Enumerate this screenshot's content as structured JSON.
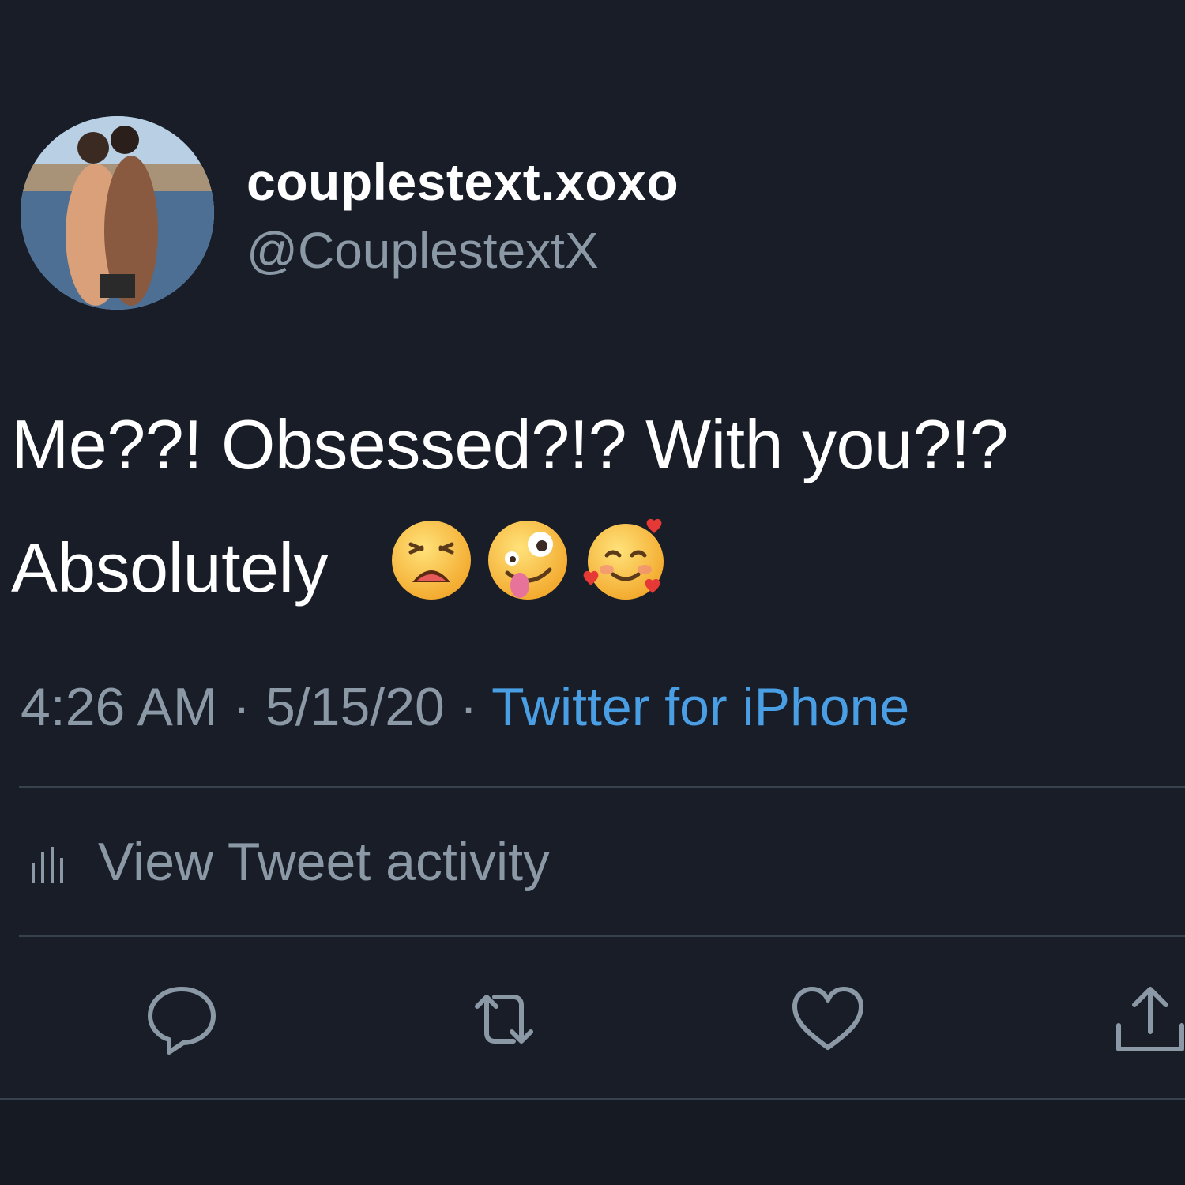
{
  "author": {
    "display_name": "couplestext.xoxo",
    "handle": "@CouplestextX",
    "avatar": "avatar-photo"
  },
  "tweet": {
    "line1": "Me??! Obsessed?!? With you?!?",
    "line2": "Absolutely",
    "emojis": [
      "weary-face",
      "zany-face",
      "smiling-face-with-hearts"
    ]
  },
  "meta": {
    "time": "4:26 AM",
    "separator": "·",
    "date": "5/15/20",
    "source": "Twitter for iPhone"
  },
  "activity": {
    "label": "View Tweet activity",
    "icon": "bar-chart-icon"
  },
  "actions": [
    "reply-icon",
    "retweet-icon",
    "like-icon",
    "share-icon"
  ],
  "colors": {
    "background": "#181d28",
    "primary_text": "#ffffff",
    "secondary_text": "#8b98a5",
    "link": "#4a9ee3",
    "divider": "#38424f"
  }
}
